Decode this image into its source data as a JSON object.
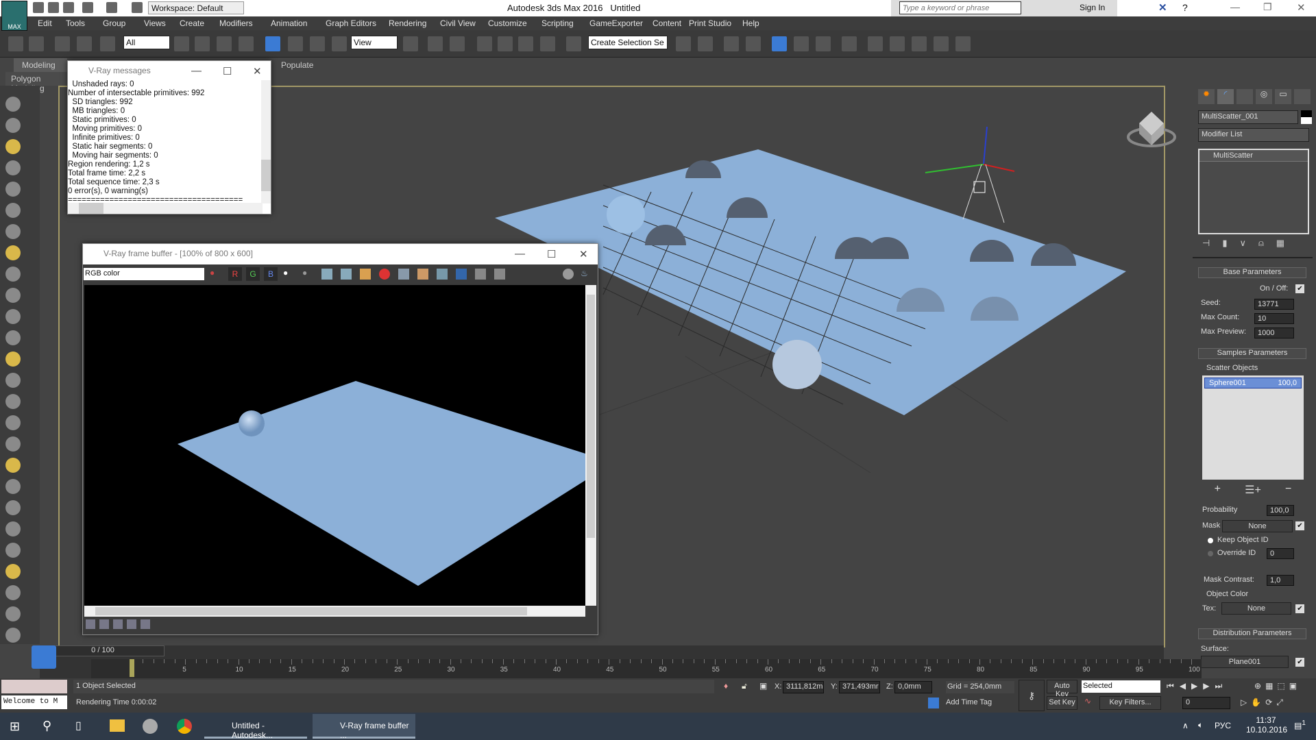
{
  "app": {
    "title": "Autodesk 3ds Max 2016",
    "doc": "Untitled",
    "workspace": "Workspace: Default",
    "logo": "MAX",
    "search_placeholder": "Type a keyword or phrase",
    "sign_in": "Sign In"
  },
  "menu": [
    "Edit",
    "Tools",
    "Group",
    "Views",
    "Create",
    "Modifiers",
    "Animation",
    "Graph Editors",
    "Rendering",
    "Civil View",
    "Customize",
    "Scripting",
    "GameExporter",
    "Content",
    "Print Studio",
    "Help"
  ],
  "toolbar": {
    "filter": "All",
    "ref_coord": "View",
    "selection_set": "Create Selection Se"
  },
  "ribbon": {
    "tabs": [
      "Modeling",
      "Populate"
    ],
    "sub": "Polygon Modeling"
  },
  "vray_messages": {
    "title": "V-Ray messages",
    "lines": [
      "  Unshaded rays: 0",
      "Number of intersectable primitives: 992",
      "  SD triangles: 992",
      "  MB triangles: 0",
      "  Static primitives: 0",
      "  Moving primitives: 0",
      "  Infinite primitives: 0",
      "  Static hair segments: 0",
      "  Moving hair segments: 0",
      "Region rendering: 1,2 s",
      "Total frame time: 2,2 s",
      "Total sequence time: 2,3 s",
      "0 error(s), 0 warning(s)",
      "======================================"
    ]
  },
  "frame_buffer": {
    "title": "V-Ray frame buffer - [100% of 800 x 600]",
    "channel": "RGB color",
    "r": "R",
    "g": "G",
    "b": "B"
  },
  "command_panel": {
    "object_name": "MultiScatter_001",
    "modifier_list": "Modifier List",
    "stack": [
      "MultiScatter"
    ],
    "base": {
      "title": "Base Parameters",
      "on_off": "On / Off:",
      "seed_label": "Seed:",
      "seed": "13771",
      "max_count_label": "Max Count:",
      "max_count": "10",
      "max_preview_label": "Max Preview:",
      "max_preview": "1000"
    },
    "samples": {
      "title": "Samples Parameters",
      "group": "Scatter Objects",
      "items": [
        {
          "name": "Sphere001",
          "value": "100,0"
        }
      ],
      "probability_label": "Probability",
      "probability": "100,0",
      "mask_label": "Mask",
      "mask": "None",
      "keep_id": "Keep Object ID",
      "override_id": "Override ID",
      "override_value": "0",
      "mask_contrast_label": "Mask Contrast:",
      "mask_contrast": "1,0",
      "object_color": "Object Color",
      "tex_label": "Tex:",
      "tex": "None"
    },
    "distribution": {
      "title": "Distribution Parameters",
      "surface_label": "Surface:",
      "surface": "Plane001"
    }
  },
  "timeline": {
    "frame": "0 / 100",
    "ticks": [
      "0",
      "5",
      "10",
      "15",
      "20",
      "25",
      "30",
      "35",
      "40",
      "45",
      "50",
      "55",
      "60",
      "65",
      "70",
      "75",
      "80",
      "85",
      "90",
      "95",
      "100"
    ]
  },
  "status": {
    "selected": "1 Object Selected",
    "render_time": "Rendering Time  0:00:02",
    "maxscript": "Welcome to M",
    "x_label": "X:",
    "x": "3111,812m",
    "y_label": "Y:",
    "y": "371,493mr",
    "z_label": "Z:",
    "z": "0,0mm",
    "grid": "Grid = 254,0mm",
    "add_time_tag": "Add Time Tag",
    "auto_key": "Auto Key",
    "set_key": "Set Key",
    "key_mode": "Selected",
    "key_filters": "Key Filters...",
    "current_frame": "0"
  },
  "taskbar": {
    "tasks": [
      "Untitled - Autodesk...",
      "V-Ray frame buffer ..."
    ],
    "lang": "РУС",
    "time": "11:37",
    "date": "10.10.2016",
    "notifications": "1"
  },
  "colors": {
    "plane": "#8cb0d8",
    "viewport_border": "#a29866",
    "accent": "#3b7bd4"
  }
}
